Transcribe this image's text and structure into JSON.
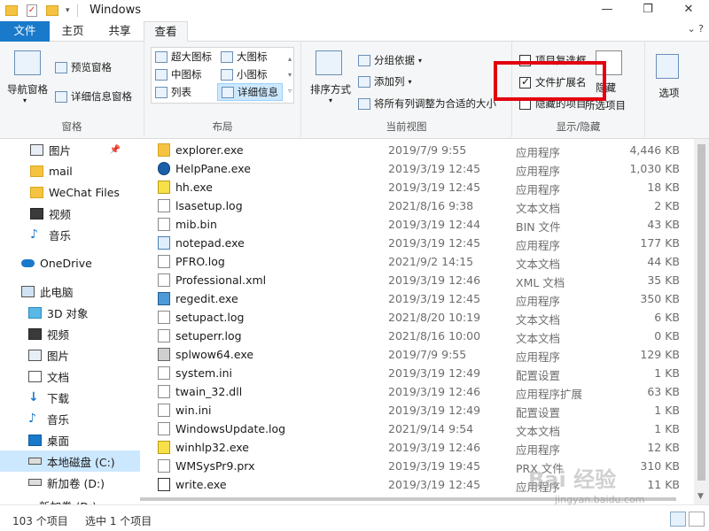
{
  "window": {
    "title": "Windows",
    "minimize": "—",
    "maximize": "❐",
    "close": "✕"
  },
  "menu": {
    "tabs": [
      "文件",
      "主页",
      "共享",
      "查看"
    ],
    "active": 3,
    "help_glyph": "⌄ ?"
  },
  "ribbon": {
    "panes": {
      "nav_pane": "导航窗格",
      "preview_pane": "预览窗格",
      "details_pane": "详细信息窗格",
      "label": "窗格"
    },
    "layout": {
      "items": [
        "超大图标",
        "大图标",
        "中图标",
        "小图标",
        "列表",
        "详细信息"
      ],
      "selected": "详细信息",
      "label": "布局"
    },
    "current_view": {
      "sort_by": "排序方式",
      "group_by": "分组依据",
      "add_columns": "添加列",
      "fit_columns": "将所有列调整为合适的大小",
      "label": "当前视图"
    },
    "show_hide": {
      "item_checkboxes": "项目复选框",
      "file_extensions": "文件扩展名",
      "hidden_items": "隐藏的项目",
      "hide_selected": "隐藏",
      "selected_items": "所选项目",
      "label": "显示/隐藏",
      "file_extensions_checked": true
    },
    "options": "选项"
  },
  "nav": {
    "items": [
      {
        "label": "图片",
        "icon": "pictures-icon",
        "pinned": true
      },
      {
        "label": "mail",
        "icon": "folder-icon"
      },
      {
        "label": "WeChat Files",
        "icon": "folder-icon"
      },
      {
        "label": "视频",
        "icon": "video-icon"
      },
      {
        "label": "音乐",
        "icon": "music-icon"
      },
      {
        "label": "OneDrive",
        "icon": "onedrive-icon"
      },
      {
        "label": "此电脑",
        "icon": "computer-icon"
      },
      {
        "label": "3D 对象",
        "icon": "3d-objects-icon"
      },
      {
        "label": "视频",
        "icon": "video-icon"
      },
      {
        "label": "图片",
        "icon": "pictures-icon"
      },
      {
        "label": "文档",
        "icon": "documents-icon"
      },
      {
        "label": "下载",
        "icon": "download-icon"
      },
      {
        "label": "音乐",
        "icon": "music-icon"
      },
      {
        "label": "桌面",
        "icon": "desktop-icon"
      },
      {
        "label": "本地磁盘 (C:)",
        "icon": "drive-icon",
        "selected": true
      },
      {
        "label": "新加卷 (D:)",
        "icon": "drive-icon"
      },
      {
        "label": "新加卷 (D:)",
        "icon": "drive-icon"
      }
    ]
  },
  "files": [
    {
      "name": "explorer.exe",
      "date": "2019/7/9 9:55",
      "type": "应用程序",
      "size": "4,446 KB",
      "icon": "folder-app-icon"
    },
    {
      "name": "HelpPane.exe",
      "date": "2019/3/19 12:45",
      "type": "应用程序",
      "size": "1,030 KB",
      "icon": "help-icon"
    },
    {
      "name": "hh.exe",
      "date": "2019/3/19 12:45",
      "type": "应用程序",
      "size": "18 KB",
      "icon": "help-file-icon"
    },
    {
      "name": "lsasetup.log",
      "date": "2021/8/16 9:38",
      "type": "文本文档",
      "size": "2 KB",
      "icon": "text-file-icon"
    },
    {
      "name": "mib.bin",
      "date": "2019/3/19 12:44",
      "type": "BIN 文件",
      "size": "43 KB",
      "icon": "file-icon"
    },
    {
      "name": "notepad.exe",
      "date": "2019/3/19 12:45",
      "type": "应用程序",
      "size": "177 KB",
      "icon": "notepad-icon"
    },
    {
      "name": "PFRO.log",
      "date": "2021/9/2 14:15",
      "type": "文本文档",
      "size": "44 KB",
      "icon": "text-file-icon"
    },
    {
      "name": "Professional.xml",
      "date": "2019/3/19 12:46",
      "type": "XML 文档",
      "size": "35 KB",
      "icon": "xml-file-icon"
    },
    {
      "name": "regedit.exe",
      "date": "2019/3/19 12:45",
      "type": "应用程序",
      "size": "350 KB",
      "icon": "regedit-icon"
    },
    {
      "name": "setupact.log",
      "date": "2021/8/20 10:19",
      "type": "文本文档",
      "size": "6 KB",
      "icon": "text-file-icon"
    },
    {
      "name": "setuperr.log",
      "date": "2021/8/16 10:00",
      "type": "文本文档",
      "size": "0 KB",
      "icon": "text-file-icon"
    },
    {
      "name": "splwow64.exe",
      "date": "2019/7/9 9:55",
      "type": "应用程序",
      "size": "129 KB",
      "icon": "printer-icon"
    },
    {
      "name": "system.ini",
      "date": "2019/3/19 12:49",
      "type": "配置设置",
      "size": "1 KB",
      "icon": "settings-file-icon"
    },
    {
      "name": "twain_32.dll",
      "date": "2019/3/19 12:46",
      "type": "应用程序扩展",
      "size": "63 KB",
      "icon": "dll-file-icon"
    },
    {
      "name": "win.ini",
      "date": "2019/3/19 12:49",
      "type": "配置设置",
      "size": "1 KB",
      "icon": "settings-file-icon"
    },
    {
      "name": "WindowsUpdate.log",
      "date": "2021/9/14 9:54",
      "type": "文本文档",
      "size": "1 KB",
      "icon": "text-file-icon"
    },
    {
      "name": "winhlp32.exe",
      "date": "2019/3/19 12:46",
      "type": "应用程序",
      "size": "12 KB",
      "icon": "help-file-icon"
    },
    {
      "name": "WMSysPr9.prx",
      "date": "2019/3/19 19:45",
      "type": "PRX 文件",
      "size": "310 KB",
      "icon": "file-icon"
    },
    {
      "name": "write.exe",
      "date": "2019/3/19 12:45",
      "type": "应用程序",
      "size": "11 KB",
      "icon": "write-icon"
    }
  ],
  "status": {
    "count": "103 个项目",
    "selected": "选中 1 个项目"
  },
  "watermark": {
    "main": "Bai 经验",
    "sub": "jingyan.baidu.com"
  },
  "colors": {
    "accent": "#1979ca",
    "selection": "#cce8ff",
    "highlight_box": "#e3000f"
  }
}
